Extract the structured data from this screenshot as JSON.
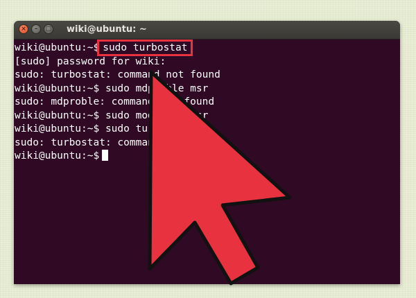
{
  "window": {
    "title": "wiki@ubuntu: ~",
    "buttons": {
      "close_glyph": "×",
      "minimize_glyph": "–",
      "maximize_glyph": "□"
    }
  },
  "terminal": {
    "lines": [
      {
        "prompt": "wiki@ubuntu:~$",
        "command": "sudo turbostat"
      },
      {
        "text": "[sudo] password for wiki:"
      },
      {
        "text": "sudo: turbostat: command not found"
      },
      {
        "text": "wiki@ubuntu:~$ sudo mdproble msr"
      },
      {
        "text": "sudo: mdproble: command not found"
      },
      {
        "text": "wiki@ubuntu:~$ sudo modprobe msr"
      },
      {
        "text": "wiki@ubuntu:~$ sudo turbostat"
      },
      {
        "text": "sudo: turbostat: command not found"
      },
      {
        "prompt": "wiki@ubuntu:~$",
        "command": ""
      }
    ]
  },
  "annotation": {
    "highlight_color": "#e8323f",
    "arrow_color": "#e8323f",
    "arrow_outline_color": "#111111"
  },
  "colors": {
    "terminal_bg": "#300a24",
    "terminal_fg": "#ffffff",
    "titlebar_bg": "#3c3b37"
  }
}
